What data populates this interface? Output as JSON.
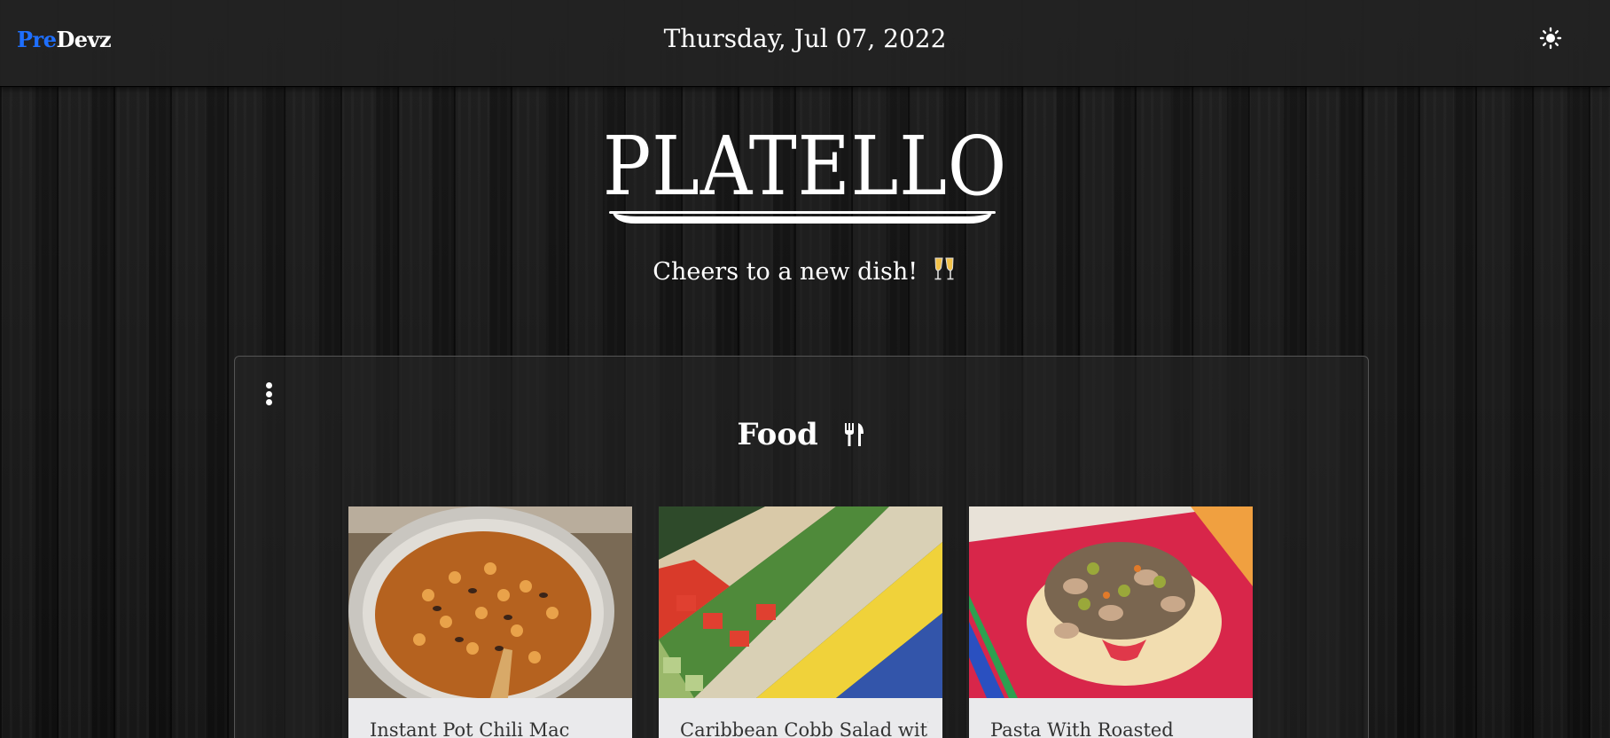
{
  "navbar": {
    "brand_pre": "Pre",
    "brand_post": "Devz",
    "date": "Thursday, Jul 07, 2022",
    "theme_icon": "sun-icon"
  },
  "hero": {
    "title": "PLATELLO",
    "tagline": "Cheers to a new dish!",
    "tagline_icon": "clinking-glasses-icon"
  },
  "panel": {
    "menu_icon": "vertical-dots-icon",
    "section_title": "Food",
    "section_icon": "fork-knife-icon",
    "cards": [
      {
        "name": "Instant Pot Chili Mac",
        "image": "chili-mac-photo"
      },
      {
        "name": "Caribbean Cobb Salad with",
        "image": "cobb-salad-photo"
      },
      {
        "name": "Pasta With Roasted",
        "image": "pasta-photo"
      }
    ]
  },
  "colors": {
    "brand_accent": "#1e6fff",
    "navbar_bg": "#222222",
    "card_bg": "#eaeaec"
  }
}
